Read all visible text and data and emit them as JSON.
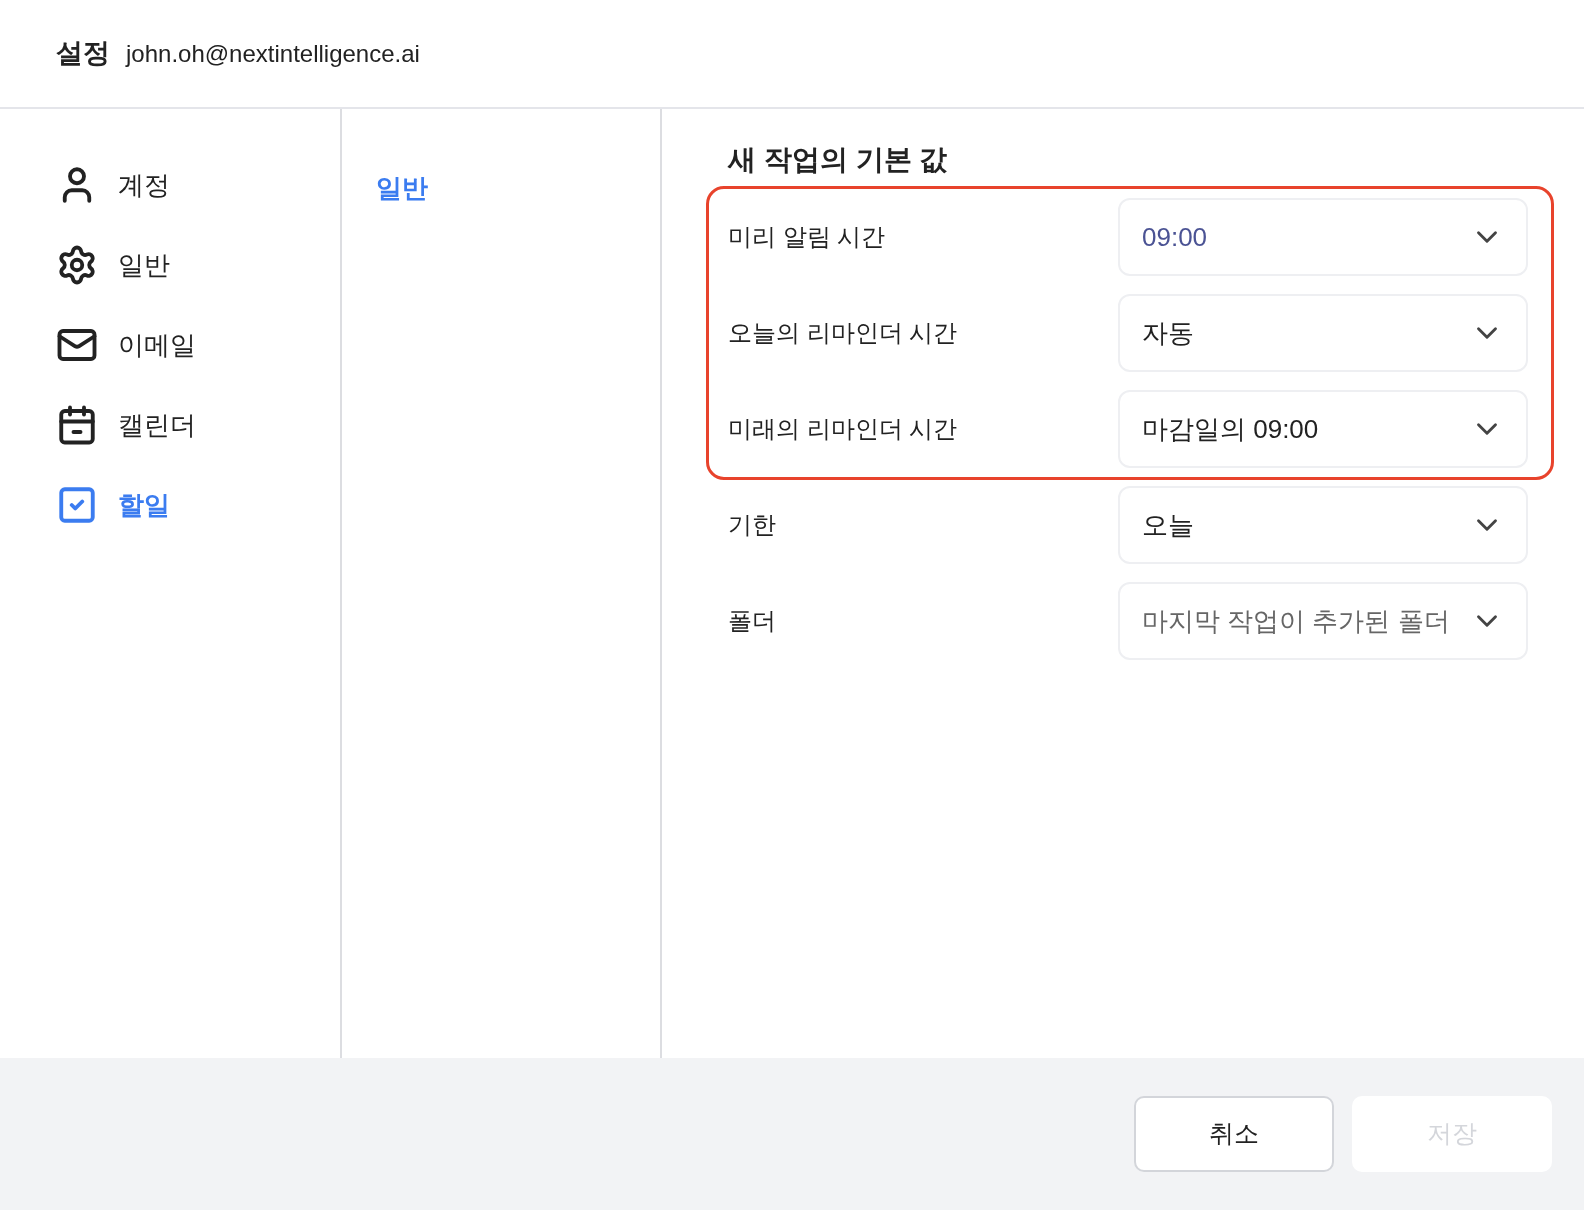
{
  "header": {
    "title": "설정",
    "account": "john.oh@nextintelligence.ai"
  },
  "sidebar": {
    "items": [
      {
        "label": "계정",
        "selected": false
      },
      {
        "label": "일반",
        "selected": false
      },
      {
        "label": "이메일",
        "selected": false
      },
      {
        "label": "캘린더",
        "selected": false
      },
      {
        "label": "할일",
        "selected": true
      }
    ]
  },
  "subnav": {
    "items": [
      {
        "label": "일반",
        "selected": true
      }
    ]
  },
  "section": {
    "title": "새 작업의 기본 값",
    "rows": [
      {
        "label": "미리 알림 시간",
        "value": "09:00",
        "kind": "accent",
        "highlighted": true
      },
      {
        "label": "오늘의 리마인더 시간",
        "value": "자동",
        "kind": "normal",
        "highlighted": true
      },
      {
        "label": "미래의 리마인더 시간",
        "value": "마감일의 09:00",
        "kind": "normal",
        "highlighted": true
      },
      {
        "label": "기한",
        "value": "오늘",
        "kind": "normal",
        "highlighted": false
      },
      {
        "label": "폴더",
        "value": "마지막 작업이 추가된 폴더",
        "kind": "muted",
        "highlighted": false
      }
    ]
  },
  "footer": {
    "buttons": [
      {
        "label": "취소",
        "disabled": false
      },
      {
        "label": "저장",
        "disabled": true
      }
    ]
  }
}
